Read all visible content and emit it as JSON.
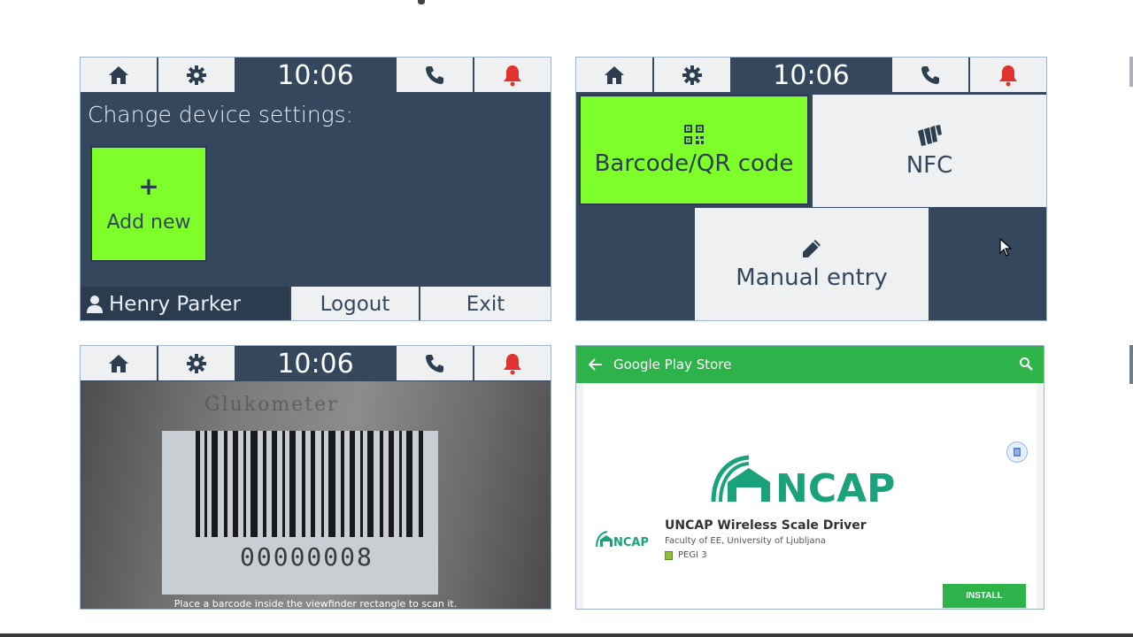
{
  "colors": {
    "panel_bg": "#34475d",
    "accent_green": "#7fff2a",
    "tile_light": "#eef0f1",
    "alarm_red": "#e0322f",
    "play_green": "#2db34a"
  },
  "device_panels": {
    "time": "10:06",
    "icons": [
      "home-icon",
      "gear-icon",
      "phone-icon",
      "bell-icon"
    ]
  },
  "settings_screen": {
    "title": "Change device settings:",
    "add_tile": {
      "plus": "+",
      "label": "Add new"
    },
    "user_name": "Henry Parker",
    "logout_label": "Logout",
    "exit_label": "Exit"
  },
  "add_method_screen": {
    "barcode_label": "Barcode/QR code",
    "nfc_label": "NFC",
    "manual_label": "Manual entry"
  },
  "scanner_screen": {
    "product_text": "Glukometer",
    "barcode_number": "00000008",
    "hint": "Place a barcode inside the viewfinder rectangle to scan it."
  },
  "play_store": {
    "bar_title": "Google Play Store",
    "app_name": "UNCAP Wireless Scale Driver",
    "developer": "Faculty of EE, University of Ljubljana",
    "rating": "PEGI 3",
    "install_label": "INSTALL",
    "logo_text": "UNCAP"
  }
}
